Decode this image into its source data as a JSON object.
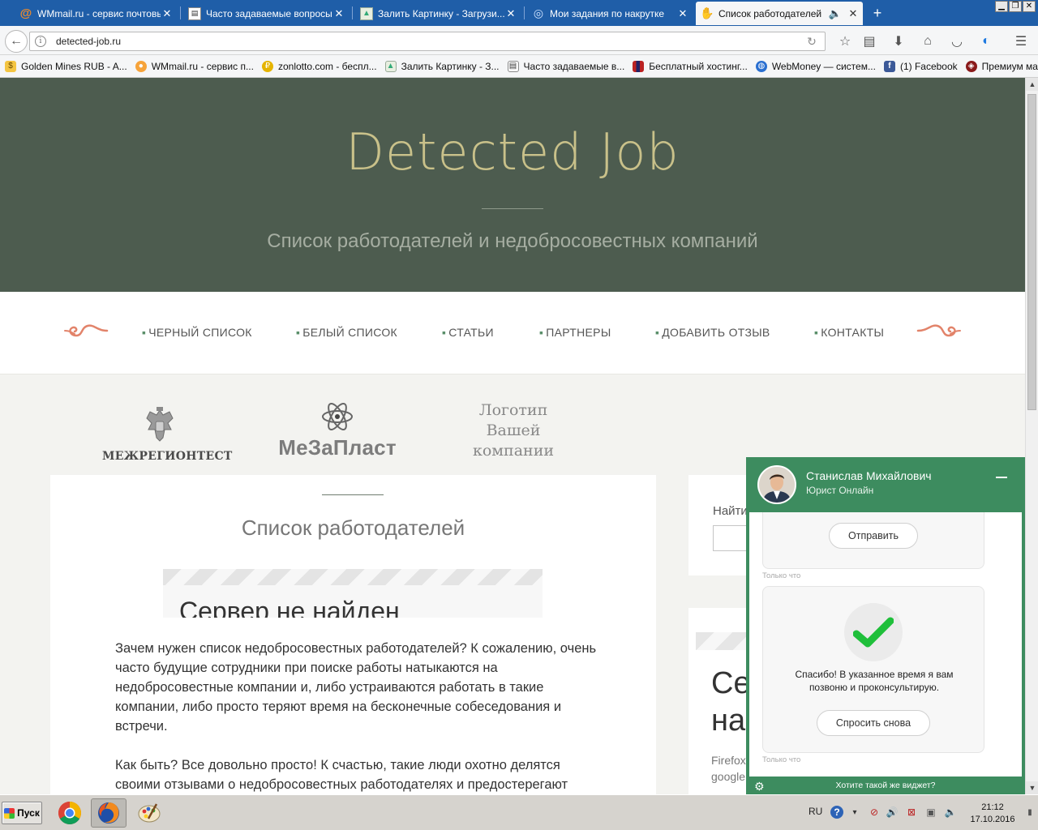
{
  "browser": {
    "tabs": [
      {
        "title": "WMmail.ru - сервис почтовы...",
        "icon": "at-sign-icon"
      },
      {
        "title": "Часто задаваемые вопросы...",
        "icon": "document-icon"
      },
      {
        "title": "Залить Картинку - Загрузи...",
        "icon": "image-icon"
      },
      {
        "title": "Мои задания по накрутке",
        "icon": "target-icon"
      },
      {
        "title": "Список работодателей",
        "icon": "hand-icon",
        "active": true
      }
    ],
    "url": "detected-job.ru",
    "bookmarks": [
      {
        "label": "Golden Mines RUB - A...",
        "icon": "dollar-icon"
      },
      {
        "label": "WMmail.ru - сервис п...",
        "icon": "cat-icon"
      },
      {
        "label": "zonlotto.com - беспл...",
        "icon": "coin-icon"
      },
      {
        "label": "Залить Картинку - З...",
        "icon": "image-icon"
      },
      {
        "label": "Часто задаваемые в...",
        "icon": "document-icon"
      },
      {
        "label": "Бесплатный хостинг...",
        "icon": "books-icon"
      },
      {
        "label": "WebMoney — систем...",
        "icon": "globe-icon"
      },
      {
        "label": "(1) Facebook",
        "icon": "facebook-icon"
      },
      {
        "label": "Премиум магазин Wa...",
        "icon": "tank-icon"
      }
    ]
  },
  "site": {
    "title": "Detected Job",
    "subtitle": "Список работодателей и недобросовестных компаний",
    "menu": [
      "ЧЕРНЫЙ СПИСОК",
      "БЕЛЫЙ СПИСОК",
      "СТАТЬИ",
      "ПАРТНЕРЫ",
      "ДОБАВИТЬ ОТЗЫВ",
      "КОНТАКТЫ"
    ],
    "partners": {
      "logo1": "МЕЖРЕГИОНТЕСТ",
      "logo2": "МеЗаПласт",
      "logo3_lines": [
        "Логотип",
        "Вашей",
        "компании"
      ]
    },
    "main": {
      "heading": "Список работодателей",
      "embedded_error": "Сервер не найден",
      "paragraphs": [
        "Зачем нужен список недобросовестных работодателей? К сожалению, очень часто будущие сотрудники при поиске работы натыкаются на недобросовестные компании и, либо устраиваются работать в такие компании, либо просто теряют время на бесконечные собеседования и встречи.",
        "Как быть? Все довольно просто! К счастью, такие люди охотно делятся своими отзывами о недобросовестных работодателях и предостерегают"
      ]
    },
    "sidebar": {
      "search_label": "Найти",
      "error_fragment_lines": [
        "Се",
        "на"
      ],
      "small_lines": [
        "Firefox",
        "google"
      ]
    }
  },
  "chat": {
    "agent_name": "Станислав Михайлович",
    "agent_role": "Юрист Онлайн",
    "send_button": "Отправить",
    "time_label": "Только что",
    "thanks_lines": [
      "Спасибо! В указанное время я вам",
      "позвоню и проконсультирую."
    ],
    "ask_again_button": "Спросить снова",
    "promo": "Хотите такой же виджет?",
    "accent": "#3d8c5f"
  },
  "taskbar": {
    "start_label": "Пуск",
    "apps": [
      {
        "name": "chrome-icon"
      },
      {
        "name": "firefox-icon",
        "active": true
      },
      {
        "name": "paint-icon"
      }
    ],
    "language": "RU",
    "time": "21:12",
    "date": "17.10.2016"
  }
}
